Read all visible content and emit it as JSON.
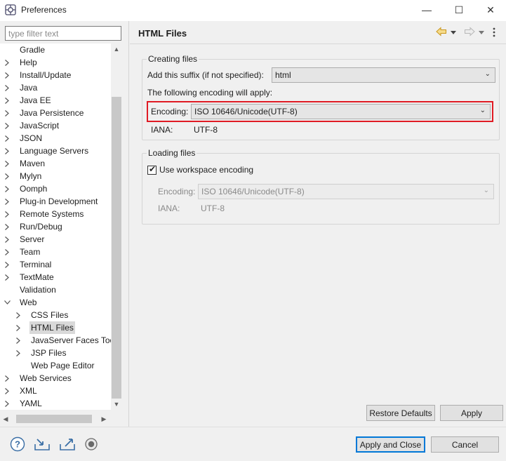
{
  "window": {
    "title": "Preferences",
    "minimize_glyph": "—",
    "maximize_glyph": "☐",
    "close_glyph": "✕"
  },
  "filter": {
    "placeholder": "type filter text",
    "value": ""
  },
  "tree": {
    "items": [
      {
        "label": "Gradle",
        "depth": 0,
        "expander": "none",
        "selected": false
      },
      {
        "label": "Help",
        "depth": 0,
        "expander": "collapsed",
        "selected": false
      },
      {
        "label": "Install/Update",
        "depth": 0,
        "expander": "collapsed",
        "selected": false
      },
      {
        "label": "Java",
        "depth": 0,
        "expander": "collapsed",
        "selected": false
      },
      {
        "label": "Java EE",
        "depth": 0,
        "expander": "collapsed",
        "selected": false
      },
      {
        "label": "Java Persistence",
        "depth": 0,
        "expander": "collapsed",
        "selected": false
      },
      {
        "label": "JavaScript",
        "depth": 0,
        "expander": "collapsed",
        "selected": false
      },
      {
        "label": "JSON",
        "depth": 0,
        "expander": "collapsed",
        "selected": false
      },
      {
        "label": "Language Servers",
        "depth": 0,
        "expander": "collapsed",
        "selected": false
      },
      {
        "label": "Maven",
        "depth": 0,
        "expander": "collapsed",
        "selected": false
      },
      {
        "label": "Mylyn",
        "depth": 0,
        "expander": "collapsed",
        "selected": false
      },
      {
        "label": "Oomph",
        "depth": 0,
        "expander": "collapsed",
        "selected": false
      },
      {
        "label": "Plug-in Development",
        "depth": 0,
        "expander": "collapsed",
        "selected": false
      },
      {
        "label": "Remote Systems",
        "depth": 0,
        "expander": "collapsed",
        "selected": false
      },
      {
        "label": "Run/Debug",
        "depth": 0,
        "expander": "collapsed",
        "selected": false
      },
      {
        "label": "Server",
        "depth": 0,
        "expander": "collapsed",
        "selected": false
      },
      {
        "label": "Team",
        "depth": 0,
        "expander": "collapsed",
        "selected": false
      },
      {
        "label": "Terminal",
        "depth": 0,
        "expander": "collapsed",
        "selected": false
      },
      {
        "label": "TextMate",
        "depth": 0,
        "expander": "collapsed",
        "selected": false
      },
      {
        "label": "Validation",
        "depth": 0,
        "expander": "none",
        "selected": false
      },
      {
        "label": "Web",
        "depth": 0,
        "expander": "expanded",
        "selected": false
      },
      {
        "label": "CSS Files",
        "depth": 1,
        "expander": "collapsed",
        "selected": false
      },
      {
        "label": "HTML Files",
        "depth": 1,
        "expander": "collapsed",
        "selected": true
      },
      {
        "label": "JavaServer Faces Too",
        "depth": 1,
        "expander": "collapsed",
        "selected": false
      },
      {
        "label": "JSP Files",
        "depth": 1,
        "expander": "collapsed",
        "selected": false
      },
      {
        "label": "Web Page Editor",
        "depth": 1,
        "expander": "none",
        "selected": false
      },
      {
        "label": "Web Services",
        "depth": 0,
        "expander": "collapsed",
        "selected": false
      },
      {
        "label": "XML",
        "depth": 0,
        "expander": "collapsed",
        "selected": false
      },
      {
        "label": "YAML",
        "depth": 0,
        "expander": "collapsed",
        "selected": false
      }
    ]
  },
  "page": {
    "title": "HTML Files",
    "creating_group": {
      "title": "Creating files",
      "suffix_label": "Add this suffix (if not specified):",
      "suffix_value": "html",
      "encoding_note": "The following encoding will apply:",
      "encoding_label": "Encoding:",
      "encoding_value": "ISO 10646/Unicode(UTF-8)",
      "iana_label": "IANA:",
      "iana_value": "UTF-8"
    },
    "loading_group": {
      "title": "Loading files",
      "use_workspace_label": "Use workspace encoding",
      "use_workspace_checked": true,
      "encoding_label": "Encoding:",
      "encoding_value": "ISO 10646/Unicode(UTF-8)",
      "iana_label": "IANA:",
      "iana_value": "UTF-8"
    },
    "restore_defaults": "Restore Defaults",
    "apply": "Apply"
  },
  "footer": {
    "apply_and_close": "Apply and Close",
    "cancel": "Cancel"
  },
  "colors": {
    "highlight": "#e01b24",
    "default_button_border": "#0078d7",
    "nav_arrow": "#d6a21e"
  }
}
